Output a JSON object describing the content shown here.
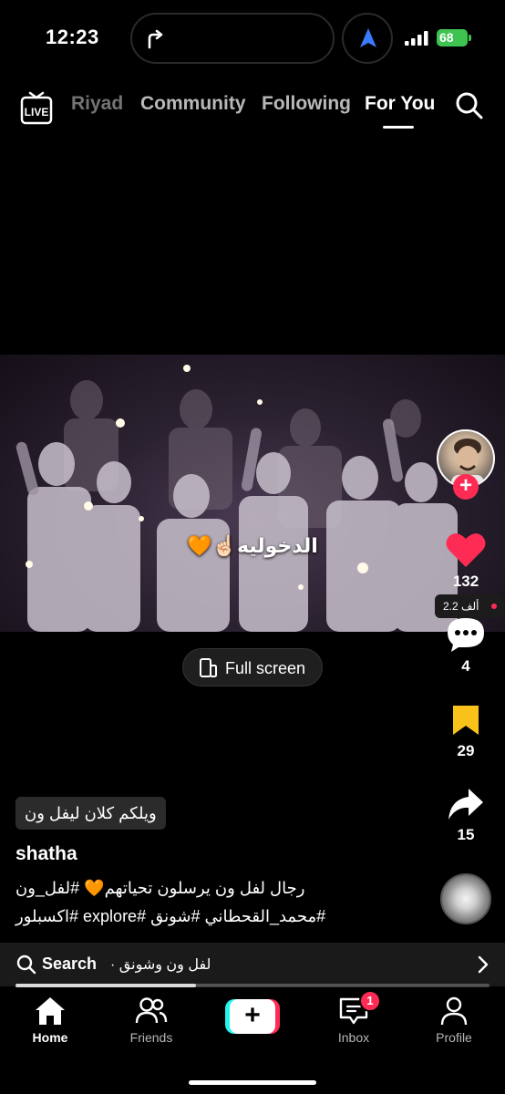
{
  "status_bar": {
    "time": "12:23",
    "battery": "68",
    "icons": [
      "turn-arrow-icon",
      "navigation-arrow-icon",
      "cellular-signal-icon",
      "battery-charging-icon"
    ]
  },
  "top_tabs": {
    "live_label": "LIVE",
    "tabs": [
      {
        "label": "Riyad",
        "active": false
      },
      {
        "label": "Community",
        "active": false
      },
      {
        "label": "Following",
        "active": false
      },
      {
        "label": "For You",
        "active": true
      }
    ]
  },
  "video": {
    "overlay_text": "الدخوليه☝🏻🧡",
    "fullscreen_label": "Full screen"
  },
  "right_rail": {
    "likes": "132",
    "viewers": "2.2 ألف",
    "comments": "4",
    "saves": "29",
    "shares": "15",
    "colors": {
      "like": "#fe2c55",
      "save": "#f9c21b",
      "follow": "#fe2c55"
    }
  },
  "post": {
    "sticker_text": "ويلكم كلان ليفل ون",
    "username": "shatha",
    "caption_line1": "رجال لفل ون يرسلون تحياتهم🧡 #لفل_ون",
    "caption_line2": "#محمد_القحطاني #شونق #explore #اكسبلور"
  },
  "search_bar": {
    "label": "Search",
    "query": "لفل ون وشونق ·",
    "progress": 0.38
  },
  "bottom_nav": {
    "items": [
      {
        "label": "Home",
        "active": true
      },
      {
        "label": "Friends",
        "active": false
      },
      {
        "label": "Inbox",
        "active": false
      },
      {
        "label": "Profile",
        "active": false
      }
    ],
    "inbox_badge": "1"
  }
}
